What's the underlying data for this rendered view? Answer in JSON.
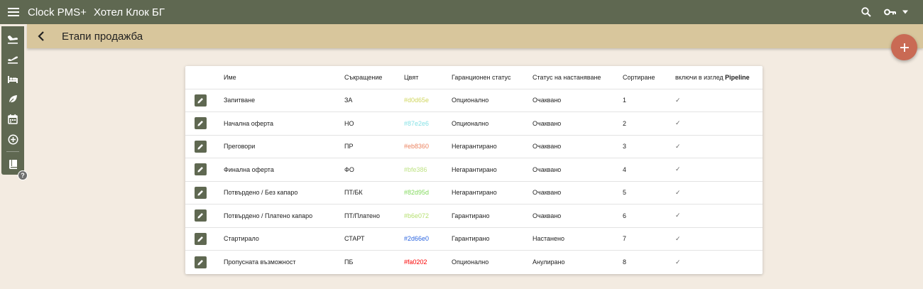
{
  "header": {
    "app_name": "Clock PMS+",
    "hotel_name": "Хотел Клок БГ"
  },
  "icons": {
    "menu": "menu-icon",
    "search": "search-icon",
    "key": "key-icon",
    "dropdown": "chevron-down-icon",
    "back": "back-arrow-icon",
    "add": "plus-icon",
    "edit": "pencil-icon",
    "check": "checkmark-icon"
  },
  "sidebar": {
    "items": [
      {
        "icon": "flight-land-icon"
      },
      {
        "icon": "flight-takeoff-icon"
      },
      {
        "icon": "bed-icon"
      },
      {
        "icon": "leaf-icon"
      },
      {
        "icon": "calendar-icon"
      },
      {
        "icon": "add-circle-icon"
      },
      {
        "icon": "book-icon"
      }
    ],
    "help_label": "?"
  },
  "page": {
    "title": "Етапи продажба"
  },
  "table": {
    "columns": {
      "name": "Име",
      "abbr": "Съкращение",
      "color": "Цвят",
      "guarantee": "Гаранционен статус",
      "status": "Статус на настаняване",
      "sort": "Сортиране",
      "pipeline_prefix": "включи в изглед ",
      "pipeline_word": "Pipeline"
    },
    "rows": [
      {
        "name": "Запитване",
        "abbr": "ЗА",
        "color": "#d0d65e",
        "guarantee": "Опционално",
        "status": "Очаквано",
        "sort": "1",
        "pipeline": "✓"
      },
      {
        "name": "Начална оферта",
        "abbr": "НО",
        "color": "#87e2e6",
        "guarantee": "Опционално",
        "status": "Очаквано",
        "sort": "2",
        "pipeline": "✓"
      },
      {
        "name": "Преговори",
        "abbr": "ПР",
        "color": "#eb8360",
        "guarantee": "Негарантирано",
        "status": "Очаквано",
        "sort": "3",
        "pipeline": "✓"
      },
      {
        "name": "Финална оферта",
        "abbr": "ФО",
        "color": "#bfe386",
        "guarantee": "Негарантирано",
        "status": "Очаквано",
        "sort": "4",
        "pipeline": "✓"
      },
      {
        "name": "Потвърдено / Без капаро",
        "abbr": "ПТ/БК",
        "color": "#82d95d",
        "guarantee": "Негарантирано",
        "status": "Очаквано",
        "sort": "5",
        "pipeline": "✓"
      },
      {
        "name": "Потвърдено / Платено капаро",
        "abbr": "ПТ/Платено",
        "color": "#b6e072",
        "guarantee": "Гарантирано",
        "status": "Очаквано",
        "sort": "6",
        "pipeline": "✓"
      },
      {
        "name": "Стартирало",
        "abbr": "СТАРТ",
        "color": "#2d66e0",
        "guarantee": "Гарантирано",
        "status": "Настанено",
        "sort": "7",
        "pipeline": "✓"
      },
      {
        "name": "Пропусната възможност",
        "abbr": "ПБ",
        "color": "#fa0202",
        "guarantee": "Опционално",
        "status": "Анулирано",
        "sort": "8",
        "pipeline": "✓"
      }
    ]
  },
  "colors": {
    "primary": "#5f6851",
    "subheader": "#d8c69c",
    "background": "#f3ebe1",
    "fab": "#c96a54"
  }
}
